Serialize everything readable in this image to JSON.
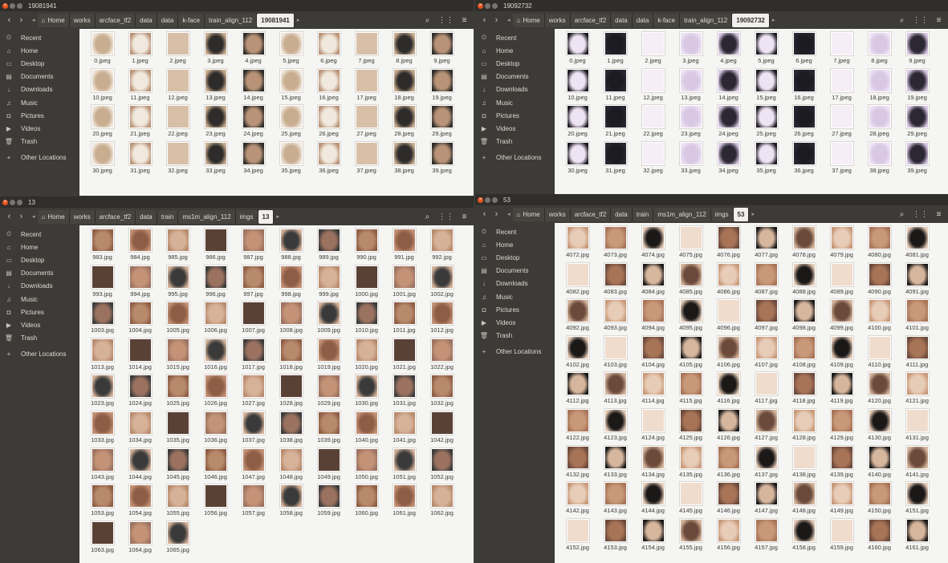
{
  "sidebar": {
    "items": [
      "Recent",
      "Home",
      "Desktop",
      "Documents",
      "Downloads",
      "Music",
      "Pictures",
      "Videos",
      "Trash"
    ],
    "other": "Other Locations"
  },
  "windows": [
    {
      "title": "19081941",
      "crumbs": [
        "works",
        "arcface_tf2",
        "data",
        "data",
        "k-face",
        "train_align_112"
      ],
      "current": "19081941",
      "ext": "jpeg",
      "files": [
        "0",
        "1",
        "2",
        "3",
        "4",
        "5",
        "6",
        "7",
        "8",
        "9",
        "10",
        "11",
        "12",
        "13",
        "14",
        "15",
        "16",
        "17",
        "18",
        "19",
        "20",
        "21",
        "22",
        "23",
        "24",
        "25",
        "26",
        "27",
        "28",
        "29",
        "30",
        "31",
        "32",
        "33",
        "34",
        "35",
        "36",
        "37",
        "38",
        "39"
      ]
    },
    {
      "title": "19092732",
      "crumbs": [
        "works",
        "arcface_tf2",
        "data",
        "data",
        "k-face",
        "train_align_112"
      ],
      "current": "19092732",
      "ext": "jpeg",
      "files": [
        "0",
        "1",
        "2",
        "3",
        "4",
        "5",
        "6",
        "7",
        "8",
        "9",
        "10",
        "11",
        "12",
        "13",
        "14",
        "15",
        "16",
        "17",
        "18",
        "19",
        "20",
        "21",
        "22",
        "23",
        "24",
        "25",
        "26",
        "27",
        "28",
        "29",
        "30",
        "31",
        "32",
        "33",
        "34",
        "35",
        "36",
        "37",
        "38",
        "39"
      ]
    },
    {
      "title": "13",
      "crumbs": [
        "works",
        "arcface_tf2",
        "data",
        "train",
        "ms1m_align_112",
        "imgs"
      ],
      "current": "13",
      "ext": "jpg",
      "files": [
        "983",
        "984",
        "985",
        "986",
        "987",
        "988",
        "989",
        "990",
        "991",
        "992",
        "993",
        "994",
        "995",
        "996",
        "997",
        "998",
        "999",
        "1000",
        "1001",
        "1002",
        "1003",
        "1004",
        "1005",
        "1006",
        "1007",
        "1008",
        "1009",
        "1010",
        "1011",
        "1012",
        "1013",
        "1014",
        "1015",
        "1016",
        "1017",
        "1018",
        "1019",
        "1020",
        "1021",
        "1022",
        "1023",
        "1024",
        "1025",
        "1026",
        "1027",
        "1028",
        "1029",
        "1030",
        "1031",
        "1032",
        "1033",
        "1034",
        "1035",
        "1036",
        "1037",
        "1038",
        "1039",
        "1040",
        "1041",
        "1042",
        "1043",
        "1044",
        "1045",
        "1046",
        "1047",
        "1048",
        "1049",
        "1050",
        "1051",
        "1052",
        "1053",
        "1054",
        "1055",
        "1056",
        "1057",
        "1058",
        "1059",
        "1060",
        "1061",
        "1062",
        "1063",
        "1064",
        "1065"
      ]
    },
    {
      "title": "53",
      "crumbs": [
        "works",
        "arcface_tf2",
        "data",
        "train",
        "ms1m_align_112",
        "imgs"
      ],
      "current": "53",
      "ext": "jpg",
      "files": [
        "4072",
        "4073",
        "4074",
        "4075",
        "4076",
        "4077",
        "4078",
        "4079",
        "4080",
        "4081",
        "4082",
        "4083",
        "4084",
        "4085",
        "4086",
        "4087",
        "4088",
        "4089",
        "4090",
        "4091",
        "4092",
        "4093",
        "4094",
        "4095",
        "4096",
        "4097",
        "4098",
        "4099",
        "4100",
        "4101",
        "4102",
        "4103",
        "4104",
        "4105",
        "4106",
        "4107",
        "4108",
        "4109",
        "4110",
        "4111",
        "4112",
        "4113",
        "4114",
        "4115",
        "4116",
        "4117",
        "4118",
        "4119",
        "4120",
        "4121",
        "4122",
        "4123",
        "4124",
        "4125",
        "4126",
        "4127",
        "4128",
        "4129",
        "4130",
        "4131",
        "4132",
        "4133",
        "4134",
        "4135",
        "4136",
        "4137",
        "4138",
        "4139",
        "4140",
        "4141",
        "4142",
        "4143",
        "4144",
        "4145",
        "4146",
        "4147",
        "4148",
        "4149",
        "4150",
        "4151",
        "4152",
        "4153",
        "4154",
        "4155",
        "4156",
        "4157",
        "4158",
        "4159",
        "4160",
        "4161"
      ]
    }
  ],
  "home_label": "Home",
  "colors": {
    "accent": "#e95420",
    "sidebar_bg": "#3c3b37",
    "content_bg": "#f5f5f4"
  },
  "thumb_tones": [
    [
      "#c9ad90",
      "#f1e9de",
      "#d8c0a8",
      "#2e2c2a",
      "#b99377"
    ],
    [
      "#efe4f4",
      "#1d1b22",
      "#f6eef7",
      "#d8c8e3",
      "#2b2733"
    ],
    [
      "#b88a6c",
      "#8d5d45",
      "#d6b299",
      "#5a4136",
      "#c49276",
      "#3a3a3a",
      "#9b7260"
    ],
    [
      "#e7cdb8",
      "#c89979",
      "#1b1818",
      "#f0dccd",
      "#a87458",
      "#d6b79e",
      "#6b4a3b"
    ]
  ]
}
